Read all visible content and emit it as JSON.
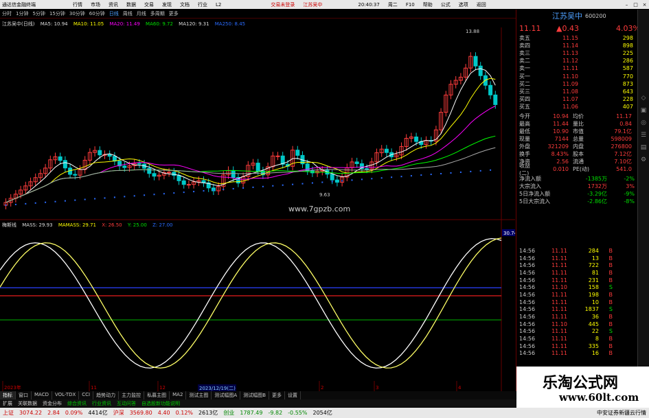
{
  "titlebar": {
    "app": "通达信金融终端",
    "menus": [
      "行情",
      "市场",
      "资讯",
      "数据",
      "交易",
      "发现",
      "文档",
      "行业",
      "",
      "L2"
    ],
    "notice1": "交易未登录",
    "notice2": "江苏吴中",
    "time": "20:40:37",
    "date": "周二",
    "right_menus": [
      "F10",
      "帮助",
      "公式",
      "选项",
      "返回"
    ]
  },
  "periods": [
    "分时",
    "1分钟",
    "5分钟",
    "15分钟",
    "30分钟",
    "60分钟",
    "日线",
    "周线",
    "月线",
    "多周期",
    "更多"
  ],
  "chart": {
    "title": "江苏吴中(日线)",
    "ma5": "MA5: 10.94",
    "ma10": "MA10: 11.05",
    "ma20": "MA20: 11.49",
    "ma60": "MA60: 9.72",
    "ma120": "MA120: 9.31",
    "ma250": "MA250: 8.45",
    "y_ticks": [
      "13.50",
      "13.00",
      "12.50",
      "12.00",
      "11.50",
      "11.00",
      "10.50",
      "10.00",
      "9.50",
      "9.00",
      "8.50",
      "8.00",
      "7.50"
    ],
    "high_label": "13.88",
    "low_label": "9.63",
    "site": "www.7gpzb.com",
    "date_hint": "2023/12/19(二)"
  },
  "indicator": {
    "name": "梅斯线",
    "mass": "MASS: 29.93",
    "mamass": "MAMASS: 29.71",
    "x": "X: 26.50",
    "y": "Y: 25.00",
    "z": "Z: 27.00",
    "y_ticks": [
      "30.00",
      "29.00",
      "28.00",
      "27.00",
      "26.00",
      "25.00",
      "24.00",
      "23.00",
      "22.00"
    ],
    "cursor_val": "30.74",
    "x_ticks": [
      "2023年",
      "11",
      "12",
      "2",
      "3",
      "4"
    ]
  },
  "stock": {
    "name": "江苏吴中",
    "code": "600200",
    "price": "11.11",
    "change": "▲0.43",
    "pct": "4.03%"
  },
  "asks": [
    {
      "l": "卖五",
      "p": "11.15",
      "v": "298"
    },
    {
      "l": "卖四",
      "p": "11.14",
      "v": "898"
    },
    {
      "l": "卖三",
      "p": "11.13",
      "v": "225"
    },
    {
      "l": "卖二",
      "p": "11.12",
      "v": "286"
    },
    {
      "l": "卖一",
      "p": "11.11",
      "v": "587"
    }
  ],
  "bids": [
    {
      "l": "买一",
      "p": "11.10",
      "v": "770"
    },
    {
      "l": "买二",
      "p": "11.09",
      "v": "873"
    },
    {
      "l": "买三",
      "p": "11.08",
      "v": "643"
    },
    {
      "l": "买四",
      "p": "11.07",
      "v": "228"
    },
    {
      "l": "买五",
      "p": "11.06",
      "v": "407"
    }
  ],
  "quote": [
    {
      "a": "今开",
      "b": "10.94",
      "c": "均价",
      "d": "11.17"
    },
    {
      "a": "最高",
      "b": "11.44",
      "c": "量比",
      "d": "0.84"
    },
    {
      "a": "最低",
      "b": "10.90",
      "c": "市值",
      "d": "79.1亿"
    },
    {
      "a": "现量",
      "b": "7144",
      "c": "总量",
      "d": "598009"
    },
    {
      "a": "外盘",
      "b": "321209",
      "c": "内盘",
      "d": "276800"
    },
    {
      "a": "换手",
      "b": "8.43%",
      "c": "股本",
      "d": "7.12亿"
    },
    {
      "a": "净资",
      "b": "2.56",
      "c": "流通",
      "d": "7.10亿"
    },
    {
      "a": "收益(二)",
      "b": "0.010",
      "c": "PE(动)",
      "d": "541.0"
    }
  ],
  "flows": [
    {
      "l": "净流入额",
      "v": "-1385万",
      "p": "-2%"
    },
    {
      "l": "大宗流入",
      "v": "1732万",
      "p": "3%"
    },
    {
      "l": "5日净流入额",
      "v": "-3.29亿",
      "p": "-9%"
    },
    {
      "l": "5日大宗流入",
      "v": "-2.86亿",
      "p": "-8%"
    }
  ],
  "ticks": [
    {
      "t": "14:56",
      "p": "11.11",
      "v": "284",
      "s": "B"
    },
    {
      "t": "14:56",
      "p": "11.11",
      "v": "13",
      "s": "B"
    },
    {
      "t": "14:56",
      "p": "11.11",
      "v": "722",
      "s": "B"
    },
    {
      "t": "14:56",
      "p": "11.11",
      "v": "81",
      "s": "B"
    },
    {
      "t": "14:56",
      "p": "11.11",
      "v": "231",
      "s": "B"
    },
    {
      "t": "14:56",
      "p": "11.10",
      "v": "158",
      "s": "S"
    },
    {
      "t": "14:56",
      "p": "11.11",
      "v": "198",
      "s": "B"
    },
    {
      "t": "14:56",
      "p": "11.11",
      "v": "10",
      "s": "B"
    },
    {
      "t": "14:56",
      "p": "11.11",
      "v": "1837",
      "s": "S"
    },
    {
      "t": "14:56",
      "p": "11.11",
      "v": "36",
      "s": "B"
    },
    {
      "t": "14:56",
      "p": "11.10",
      "v": "445",
      "s": "B"
    },
    {
      "t": "14:56",
      "p": "11.11",
      "v": "22",
      "s": "S"
    },
    {
      "t": "14:56",
      "p": "11.11",
      "v": "8",
      "s": "B"
    },
    {
      "t": "14:56",
      "p": "11.11",
      "v": "335",
      "s": "B"
    },
    {
      "t": "14:56",
      "p": "11.11",
      "v": "16",
      "s": "B"
    }
  ],
  "bottom_tabs": [
    "指标",
    "窗口",
    "MACD",
    "VOL-TDX",
    "CCI",
    "趋势动力",
    "主力监控",
    "私募主图",
    "MA2",
    "测试主图",
    "测试幅图A",
    "测试幅图B",
    "更多",
    "设置"
  ],
  "sub_tabs": [
    "扩展",
    "关联数据",
    "资金分布",
    "综合资讯",
    "行业资讯",
    "互动问答",
    "自选股新功能说明"
  ],
  "status": {
    "sh_name": "上证",
    "sh_val": "3074.22",
    "sh_chg": "2.84",
    "sh_pct": "0.09%",
    "sh_amt": "4414亿",
    "sz_name": "沪深",
    "sz_val": "3569.80",
    "sz_chg": "4.40",
    "sz_pct": "0.12%",
    "sz_amt": "2613亿",
    "cy_name": "创业",
    "cy_val": "1787.49",
    "cy_chg": "-9.82",
    "cy_pct": "-0.55%",
    "cy_amt": "2054亿",
    "broker": "中安证券新疆云行情"
  },
  "watermark": {
    "line1": "乐淘公式网",
    "line2": "www.60lt.com"
  },
  "colors": {
    "up": "#ff3c3c",
    "down": "#00c8c8",
    "mass": "#ffffff",
    "mamass": "#ffff66",
    "ma5": "#ffffff",
    "ma10": "#ffff00",
    "ma20": "#ff00ff",
    "ma60": "#00ff00",
    "ma120": "#aaaaaa",
    "ma250": "#2a6cff"
  }
}
